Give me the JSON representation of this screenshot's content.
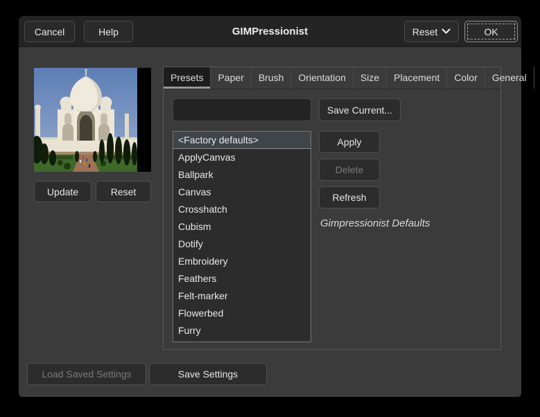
{
  "window": {
    "title": "GIMPressionist"
  },
  "titlebar": {
    "cancel": "Cancel",
    "help": "Help",
    "reset": "Reset",
    "ok": "OK"
  },
  "preview": {
    "update": "Update",
    "reset": "Reset",
    "image_subject": "taj-mahal-photo"
  },
  "tabs": {
    "active": "Presets",
    "items": [
      "Presets",
      "Paper",
      "Brush",
      "Orientation",
      "Size",
      "Placement",
      "Color",
      "General"
    ]
  },
  "presets": {
    "name_input": {
      "value": ""
    },
    "save_current": "Save Current...",
    "apply": "Apply",
    "delete": "Delete",
    "refresh": "Refresh",
    "description": "Gimpressionist Defaults",
    "selected": "<Factory defaults>",
    "items": [
      "<Factory defaults>",
      "ApplyCanvas",
      "Ballpark",
      "Canvas",
      "Crosshatch",
      "Cubism",
      "Dotify",
      "Embroidery",
      "Feathers",
      "Felt-marker",
      "Flowerbed",
      "Furry"
    ]
  },
  "footer": {
    "load_saved": "Load Saved Settings",
    "save_settings": "Save Settings"
  },
  "colors": {
    "titlebar_bg": "#242424",
    "window_bg": "#3b3b3b",
    "button_bg": "#2c2c2c",
    "list_bg": "#2c2c2c",
    "list_selected_bg": "#40454a",
    "active_tab_bg": "#1d1d1d",
    "text": "#e8e8e8",
    "disabled_text": "#7a7a7a"
  }
}
